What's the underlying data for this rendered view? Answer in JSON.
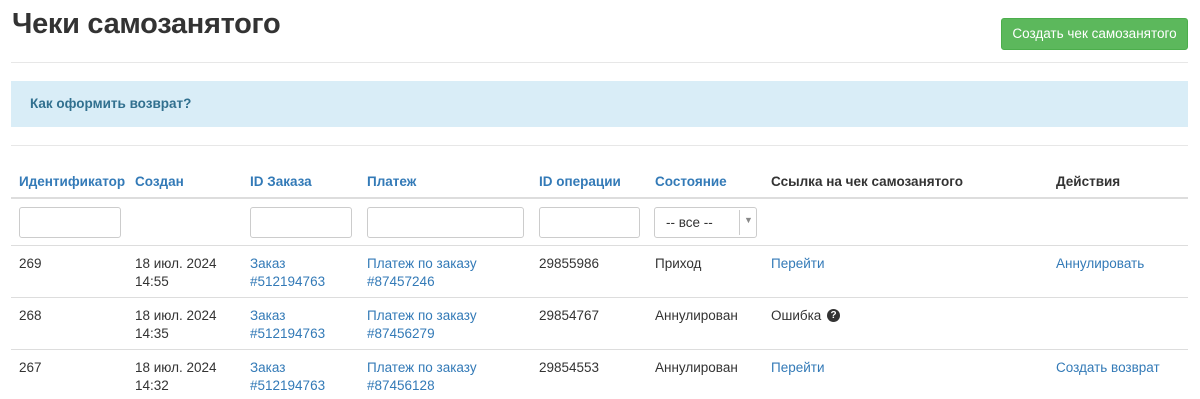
{
  "header": {
    "title": "Чеки самозанятого",
    "create_button": "Создать чек самозанятого"
  },
  "info": {
    "link_text": "Как оформить возврат?"
  },
  "table": {
    "columns": [
      "Идентификатор",
      "Создан",
      "ID Заказа",
      "Платеж",
      "ID операции",
      "Состояние",
      "Ссылка на чек самозанятого",
      "Действия"
    ],
    "filters": {
      "status_selected": "-- все --"
    },
    "rows": [
      {
        "id": "269",
        "created_date": "18 июл. 2024",
        "created_time": "14:55",
        "order_line1": "Заказ",
        "order_line2": "#512194763",
        "payment_line1": "Платеж по заказу",
        "payment_line2": "#87457246",
        "operation_id": "29855986",
        "status": "Приход",
        "receipt_link": "Перейти",
        "action": "Аннулировать"
      },
      {
        "id": "268",
        "created_date": "18 июл. 2024",
        "created_time": "14:35",
        "order_line1": "Заказ",
        "order_line2": "#512194763",
        "payment_line1": "Платеж по заказу",
        "payment_line2": "#87456279",
        "operation_id": "29854767",
        "status": "Аннулирован",
        "receipt_error": "Ошибка",
        "help_icon": "question-circle-icon"
      },
      {
        "id": "267",
        "created_date": "18 июл. 2024",
        "created_time": "14:32",
        "order_line1": "Заказ",
        "order_line2": "#512194763",
        "payment_line1": "Платеж по заказу",
        "payment_line2": "#87456128",
        "operation_id": "29854553",
        "status": "Аннулирован",
        "receipt_link": "Перейти",
        "action": "Создать возврат"
      }
    ]
  },
  "colors": {
    "link": "#337ab7",
    "success_button": "#5cb85c",
    "info_background": "#d9edf7",
    "info_text": "#31708f",
    "text": "#333333"
  }
}
